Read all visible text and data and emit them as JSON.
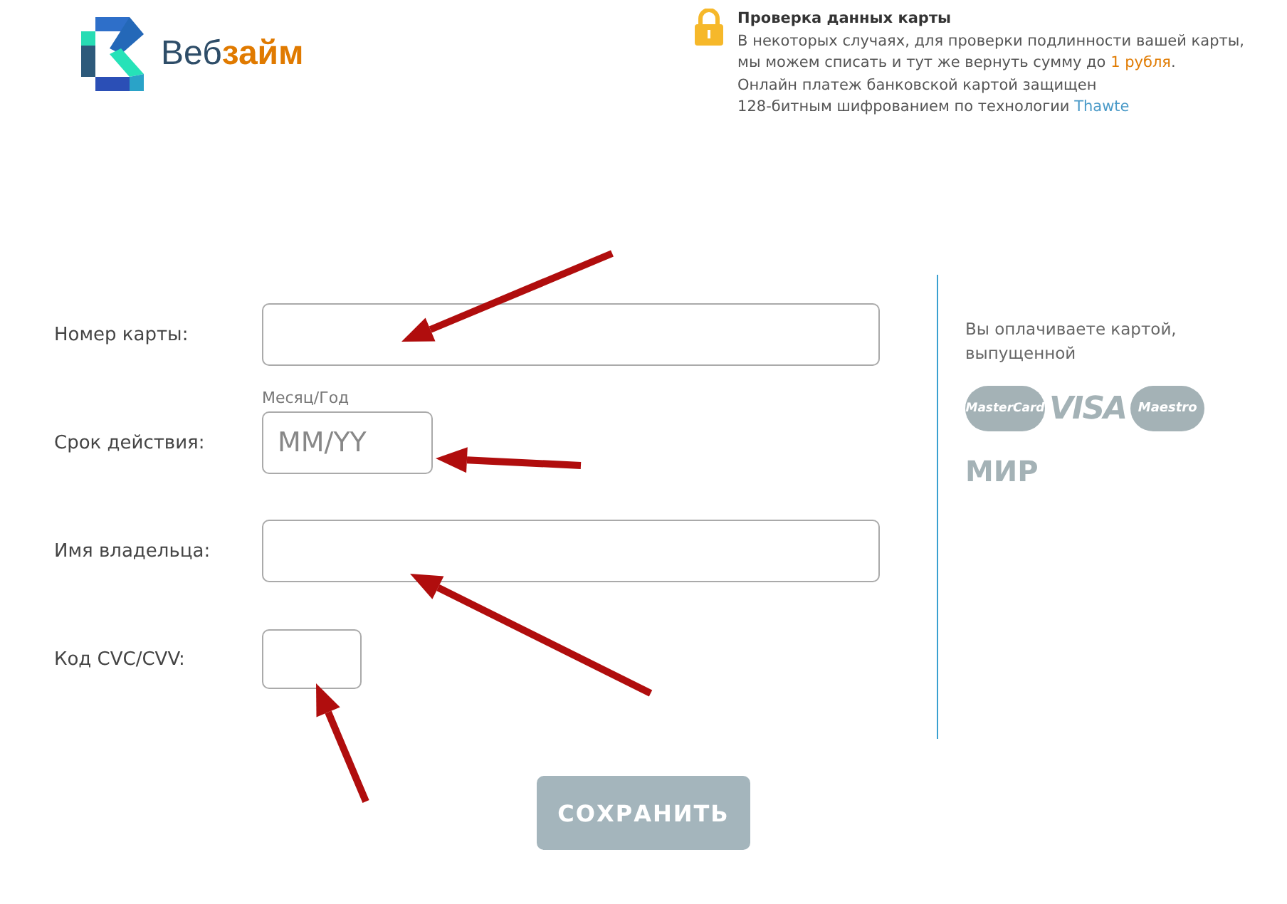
{
  "logo": {
    "text_light": "Веб",
    "text_bold": "займ"
  },
  "security_note": {
    "title": "Проверка данных карты",
    "lines": [
      "В некоторых случаях, для проверки подлинности вашей карты,",
      "мы можем списать и тут же вернуть сумму до **1 рубля**."
    ],
    "lines2": [
      "Онлайн платеж банковской картой защищен"
    ],
    "last_line": "128-битным шифрованием по технологии",
    "link": "Thawte"
  },
  "form": {
    "fields": [
      {
        "kind": "wide",
        "label": "Номер карты:"
      },
      {
        "kind": "date",
        "label": "Срок действия:",
        "hint": "Месяц/Год",
        "placeholder": "MM/YY"
      },
      {
        "kind": "wide",
        "label": "Имя владельца:"
      },
      {
        "kind": "small",
        "label": "Код CVC/CVV:"
      }
    ]
  },
  "cards_info": {
    "text": "Вы оплачиваете картой, выпущенной",
    "brands": [
      {
        "kind": "mastercard",
        "text": "MasterCard"
      },
      {
        "kind": "visa",
        "text": "VISA"
      },
      {
        "kind": "maestro",
        "text": "Maestro"
      },
      {
        "kind": "mir",
        "text": "МИР"
      }
    ]
  },
  "save_button": "СОХРАНИТЬ"
}
